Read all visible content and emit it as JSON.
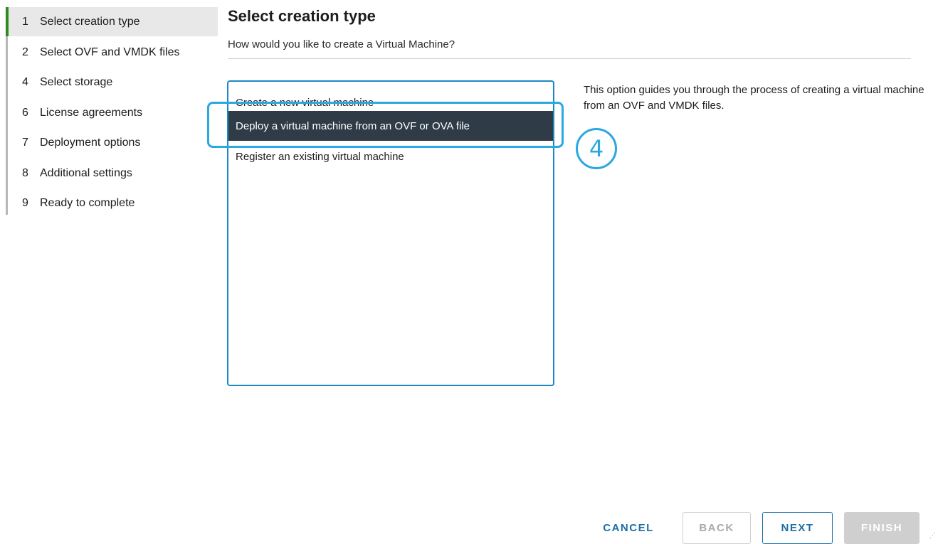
{
  "steps": [
    {
      "num": "1",
      "label": "Select creation type"
    },
    {
      "num": "2",
      "label": "Select OVF and VMDK files"
    },
    {
      "num": "4",
      "label": "Select storage"
    },
    {
      "num": "6",
      "label": "License agreements"
    },
    {
      "num": "7",
      "label": "Deployment options"
    },
    {
      "num": "8",
      "label": "Additional settings"
    },
    {
      "num": "9",
      "label": "Ready to complete"
    }
  ],
  "active_step": "1",
  "main": {
    "title": "Select creation type",
    "subtitle": "How would you like to create a Virtual Machine?",
    "options": [
      "Create a new virtual machine",
      "Deploy a virtual machine from an OVF or OVA file",
      "Register an existing virtual machine"
    ],
    "selected_option": "Deploy a virtual machine from an OVF or OVA file",
    "description": "This option guides you through the process of creating a virtual machine from an OVF and VMDK files.",
    "callout_number": "4"
  },
  "footer": {
    "cancel": "CANCEL",
    "back": "BACK",
    "next": "NEXT",
    "finish": "FINISH"
  },
  "colors": {
    "accent": "#1d6fa3",
    "callout": "#29a8e1",
    "selected_bg": "#2f3c48",
    "active_step_marker": "#2f8a1f"
  }
}
